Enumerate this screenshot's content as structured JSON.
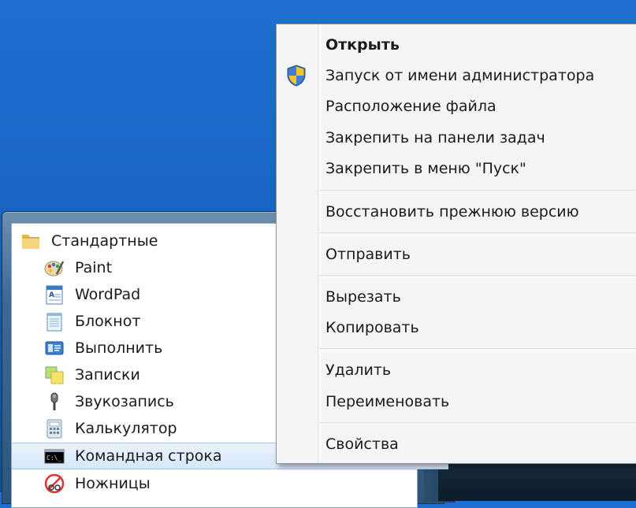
{
  "context_menu": {
    "items": [
      {
        "label": "Открыть",
        "bold": true
      },
      {
        "label": "Запуск от имени администратора",
        "icon": "uac-shield-icon"
      },
      {
        "label": "Расположение файла"
      },
      {
        "label": "Закрепить на панели задач"
      },
      {
        "label": "Закрепить в меню \"Пуск\""
      },
      {
        "label": "Восстановить прежнюю версию"
      },
      {
        "label": "Отправить"
      },
      {
        "label": "Вырезать"
      },
      {
        "label": "Копировать"
      },
      {
        "label": "Удалить"
      },
      {
        "label": "Переименовать"
      },
      {
        "label": "Свойства"
      }
    ]
  },
  "programs": {
    "folder": {
      "label": "Стандартные",
      "icon": "folder-icon"
    },
    "items": [
      {
        "label": "Paint",
        "icon": "paint-icon"
      },
      {
        "label": "WordPad",
        "icon": "wordpad-icon"
      },
      {
        "label": "Блокнот",
        "icon": "notepad-icon"
      },
      {
        "label": "Выполнить",
        "icon": "run-icon"
      },
      {
        "label": "Записки",
        "icon": "sticky-notes-icon"
      },
      {
        "label": "Звукозапись",
        "icon": "microphone-icon"
      },
      {
        "label": "Калькулятор",
        "icon": "calculator-icon"
      },
      {
        "label": "Командная строка",
        "icon": "cmd-icon",
        "selected": true
      },
      {
        "label": "Ножницы",
        "icon": "scissors-icon"
      }
    ]
  },
  "colors": {
    "desktop": "#1a67c8",
    "menu_bg": "#f5f5f5",
    "selection": "#d6e8fb"
  }
}
